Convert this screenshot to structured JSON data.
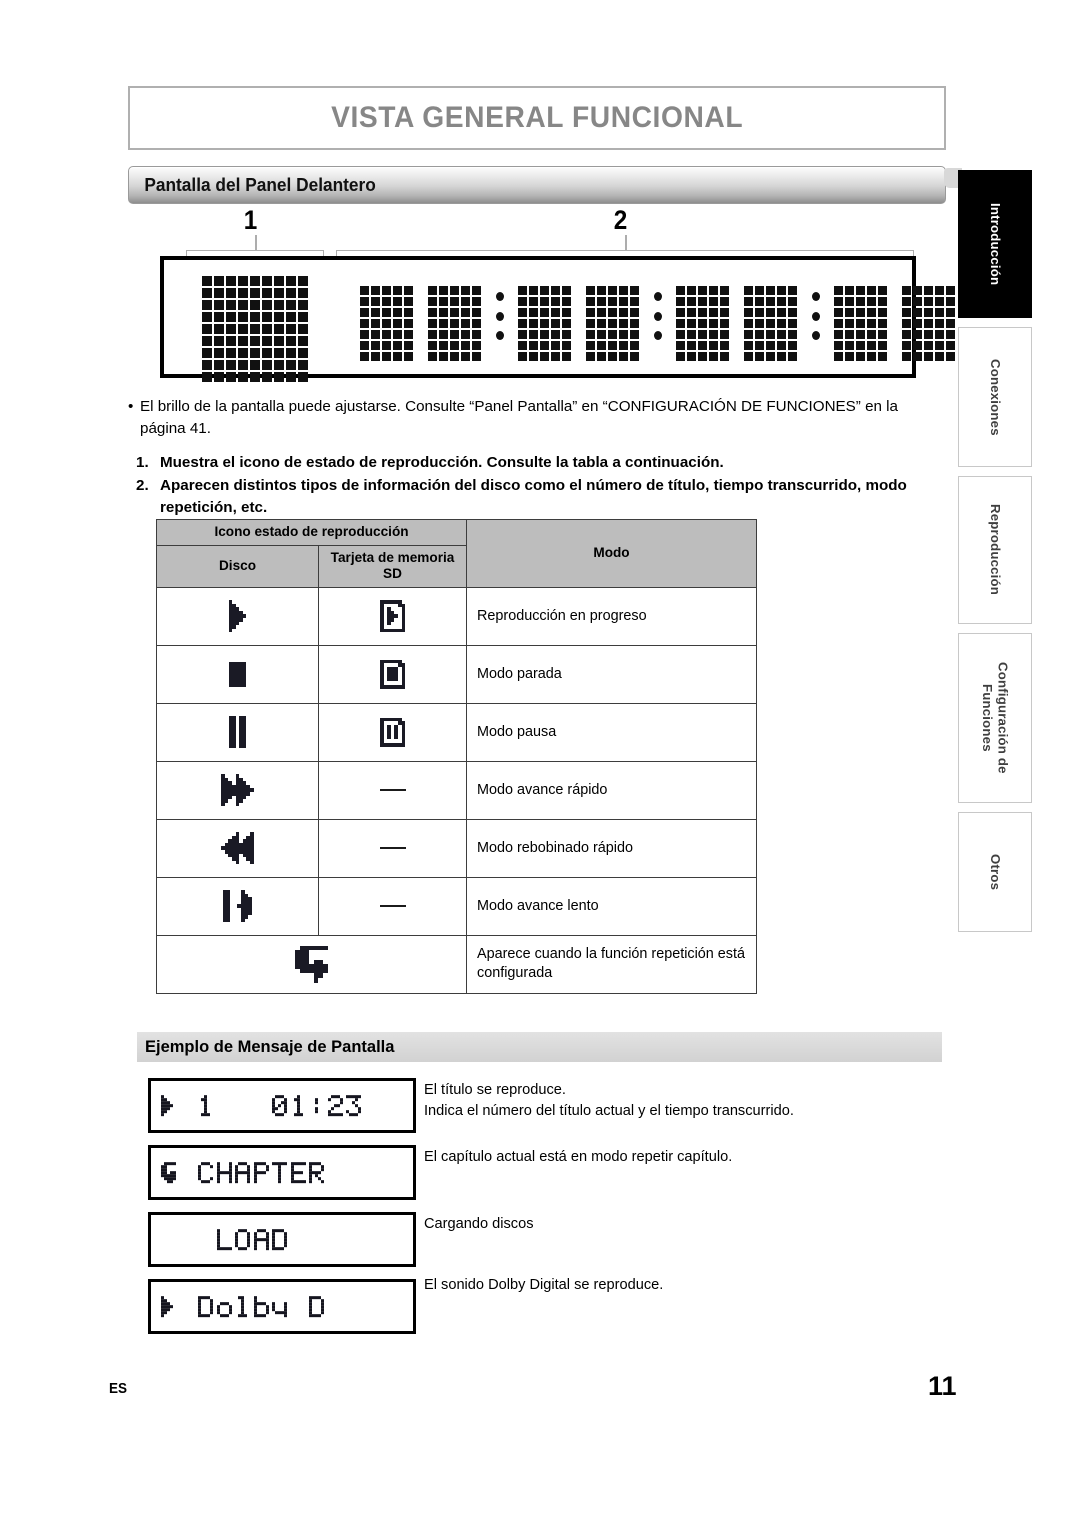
{
  "header": {
    "chapter_title": "VISTA GENERAL FUNCIONAL",
    "section_title": "Pantalla del Panel Delantero"
  },
  "callouts": [
    {
      "number": "1"
    },
    {
      "number": "2"
    }
  ],
  "note": {
    "bullet": "El brillo de la pantalla puede ajustarse. Consulte “Panel Pantalla” en “CONFIGURACIÓN DE FUNCIONES” en la página 41."
  },
  "numbered_list": [
    {
      "n": "1.",
      "text": "Muestra el icono de estado de reproducción. Consulte la tabla a continuación."
    },
    {
      "n": "2.",
      "text": "Aparecen distintos tipos de información del disco como el número de título, tiempo transcurrido, modo repetición, etc."
    }
  ],
  "icon_table": {
    "group_header": "Icono estado de reproducción",
    "col_disc": "Disco",
    "col_sd": "Tarjeta de memoria SD",
    "col_mode": "Modo",
    "rows": [
      {
        "disc_icon": "play-icon",
        "sd_icon": "sd-play-icon",
        "mode": "Reproducción en progreso"
      },
      {
        "disc_icon": "stop-icon",
        "sd_icon": "sd-stop-icon",
        "mode": "Modo parada"
      },
      {
        "disc_icon": "pause-icon",
        "sd_icon": "sd-pause-icon",
        "mode": "Modo pausa"
      },
      {
        "disc_icon": "forward-icon",
        "sd_icon": "dash",
        "mode": "Modo avance rápido"
      },
      {
        "disc_icon": "rewind-icon",
        "sd_icon": "dash",
        "mode": "Modo rebobinado rápido"
      },
      {
        "disc_icon": "slow-icon",
        "sd_icon": "dash",
        "mode": "Modo avance lento"
      },
      {
        "disc_icon": "repeat-icon",
        "sd_icon": "",
        "mode": "Aparece cuando la función repetición está configurada"
      }
    ]
  },
  "example_section": {
    "title": "Ejemplo de Mensaje de Pantalla",
    "items": [
      {
        "lcd_text": "▶  1      01:23",
        "descriptions": [
          "El título se reproduce.",
          "Indica el número del título actual y el tiempo transcurrido."
        ]
      },
      {
        "lcd_text": "↺ CHAPTER",
        "descriptions": [
          "El capítulo actual está en modo repetir capítulo."
        ]
      },
      {
        "lcd_text": "LOAD",
        "descriptions": [
          "Cargando discos"
        ]
      },
      {
        "lcd_text": "▶ Dolby D",
        "descriptions": [
          "El sonido Dolby Digital se reproduce."
        ]
      }
    ]
  },
  "side_tabs": [
    {
      "label": "Introducción",
      "active": true
    },
    {
      "label": "Conexiones",
      "active": false
    },
    {
      "label": "Reproducción",
      "active": false
    },
    {
      "label": "Configuración de Funciones",
      "active": false
    },
    {
      "label": "Otros",
      "active": false
    }
  ],
  "footer": {
    "language_code": "ES",
    "page_number": "11"
  },
  "colors": {
    "chapter_title": "#878787",
    "table_header_bg": "#bdbdbd",
    "active_tab_bg": "#000000",
    "ink": "#111111"
  }
}
